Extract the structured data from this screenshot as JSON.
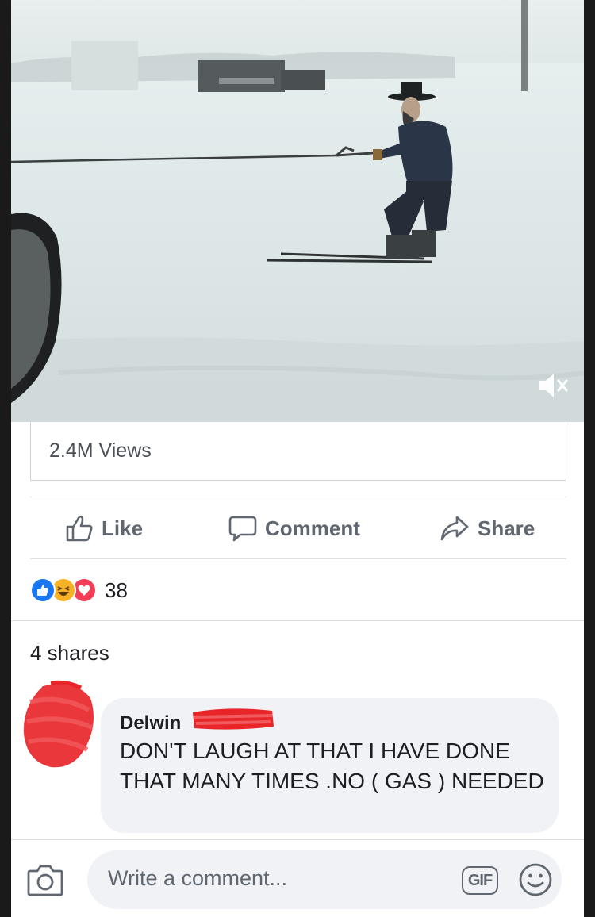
{
  "video": {
    "mute_icon": "volume-muted-icon"
  },
  "stats": {
    "views": "2.4M Views",
    "reaction_count": "38",
    "shares": "4 shares"
  },
  "reactions": [
    "like",
    "haha",
    "love"
  ],
  "actions": {
    "like": "Like",
    "comment": "Comment",
    "share": "Share"
  },
  "comment": {
    "author": "Delwin",
    "text": "DON'T LAUGH AT THAT I HAVE DONE THAT MANY TIMES .NO ( GAS ) NEEDED"
  },
  "composer": {
    "placeholder": "Write a comment...",
    "gif_label": "GIF"
  },
  "colors": {
    "like_blue": "#1877f2",
    "love_red": "#f33e58",
    "haha_yellow": "#f7b125",
    "redaction_red": "#e8262a",
    "text_gray": "#606770"
  }
}
